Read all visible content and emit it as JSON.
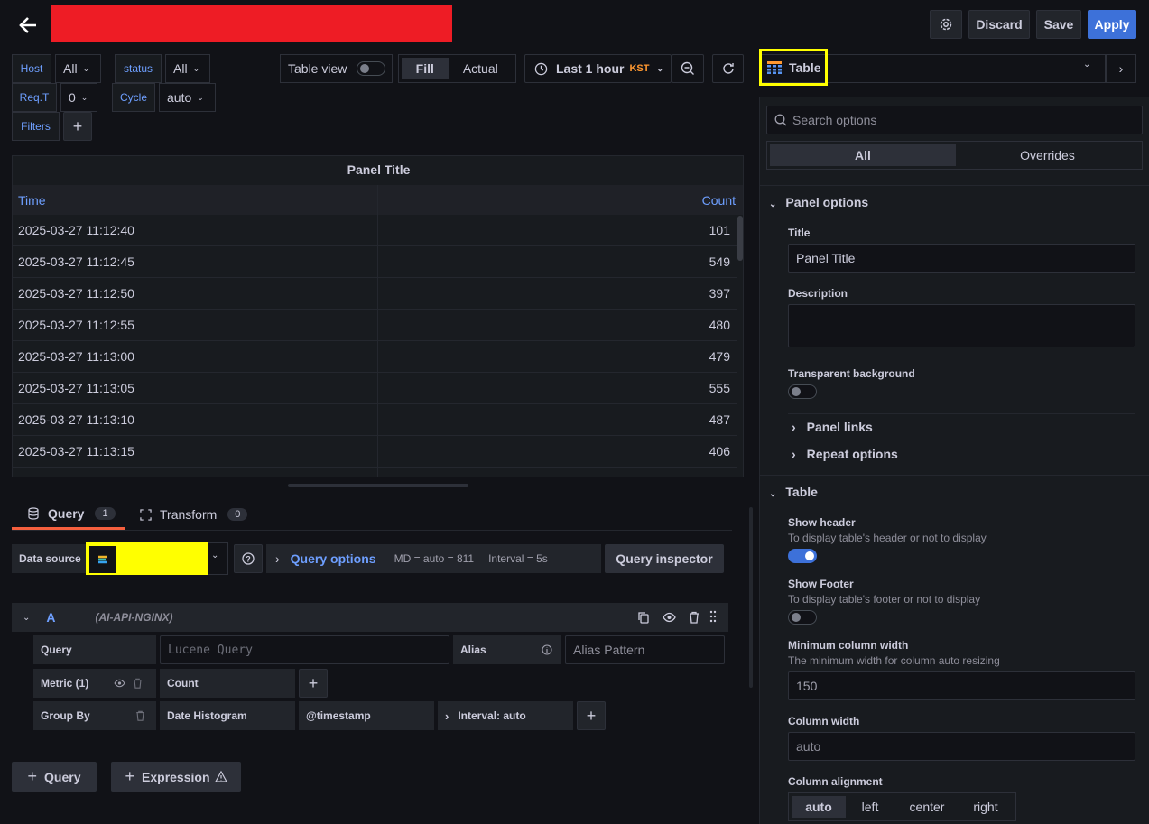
{
  "header": {
    "discard": "Discard",
    "save": "Save",
    "apply": "Apply"
  },
  "vars": {
    "host": {
      "label": "Host",
      "value": "All"
    },
    "status": {
      "label": "status",
      "value": "All"
    },
    "reqt": {
      "label": "Req.T",
      "value": "0"
    },
    "cycle": {
      "label": "Cycle",
      "value": "auto"
    },
    "filters": "Filters"
  },
  "toolbar": {
    "table_view": "Table view",
    "fill": "Fill",
    "actual": "Actual",
    "time_range": "Last 1 hour",
    "tz": "KST"
  },
  "viz": {
    "name": "Table"
  },
  "panel": {
    "title": "Panel Title",
    "columns": [
      "Time",
      "Count"
    ],
    "rows": [
      [
        "2025-03-27 11:12:40",
        "101"
      ],
      [
        "2025-03-27 11:12:45",
        "549"
      ],
      [
        "2025-03-27 11:12:50",
        "397"
      ],
      [
        "2025-03-27 11:12:55",
        "480"
      ],
      [
        "2025-03-27 11:13:00",
        "479"
      ],
      [
        "2025-03-27 11:13:05",
        "555"
      ],
      [
        "2025-03-27 11:13:10",
        "487"
      ],
      [
        "2025-03-27 11:13:15",
        "406"
      ]
    ]
  },
  "tabs": {
    "query": "Query",
    "query_count": "1",
    "transform": "Transform",
    "transform_count": "0"
  },
  "query_bar": {
    "datasource_label": "Data source",
    "query_options": "Query options",
    "md": "MD = auto = 811",
    "interval": "Interval = 5s",
    "inspector": "Query inspector"
  },
  "query_row": {
    "ref": "A",
    "name": "(AI-API-NGINX)",
    "query_label": "Query",
    "query_placeholder": "Lucene Query",
    "alias_label": "Alias",
    "alias_placeholder": "Alias Pattern",
    "metric_label": "Metric (1)",
    "metric_value": "Count",
    "groupby_label": "Group By",
    "groupby_value": "Date Histogram",
    "groupby_field": "@timestamp",
    "groupby_interval": "Interval: auto"
  },
  "add": {
    "query": "Query",
    "expression": "Expression"
  },
  "options": {
    "search_placeholder": "Search options",
    "tab_all": "All",
    "tab_overrides": "Overrides",
    "panel_options": "Panel options",
    "title_label": "Title",
    "title_value": "Panel Title",
    "description_label": "Description",
    "transparent_label": "Transparent background",
    "panel_links": "Panel links",
    "repeat_options": "Repeat options",
    "table_section": "Table",
    "show_header": "Show header",
    "show_header_desc": "To display table's header or not to display",
    "show_footer": "Show Footer",
    "show_footer_desc": "To display table's footer or not to display",
    "min_col_width": "Minimum column width",
    "min_col_width_desc": "The minimum width for column auto resizing",
    "min_col_width_value": "150",
    "col_width": "Column width",
    "col_width_value": "auto",
    "col_align": "Column alignment",
    "align_options": [
      "auto",
      "left",
      "center",
      "right"
    ]
  },
  "colors": {
    "accent": "#3d71d9",
    "link": "#6e9fff",
    "highlight": "#ffff00",
    "redact": "#ee1c25",
    "tz": "#ff9830"
  }
}
